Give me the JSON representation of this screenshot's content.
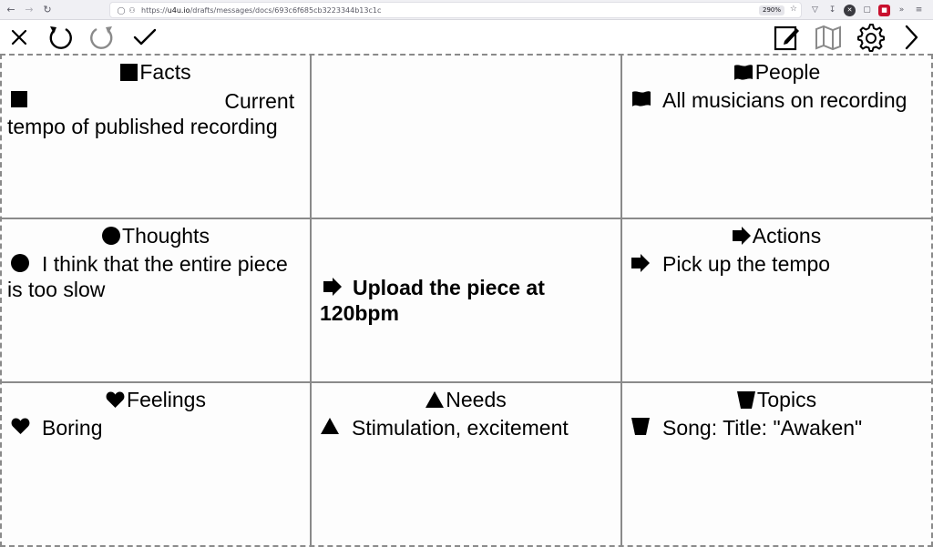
{
  "browser": {
    "url_prefix": "https://",
    "url_host": "u4u.io",
    "url_path": "/drafts/messages/docs/693c6f685cb3223344b13c1c",
    "zoom": "290%"
  },
  "toolbar": {
    "left_buttons": [
      "close-icon",
      "undo-icon",
      "redo-icon",
      "check-icon"
    ],
    "right_buttons": [
      "edit-icon",
      "map-icon",
      "gear-icon",
      "chevron-right-icon"
    ]
  },
  "cells": {
    "facts": {
      "title": "Facts",
      "icon": "square-icon",
      "item": "Current tempo of published recording"
    },
    "people": {
      "title": "People",
      "icon": "flag-icon",
      "item": "All musicians on recording"
    },
    "thoughts": {
      "title": "Thoughts",
      "icon": "circle-icon",
      "item": "I think that the entire piece is too slow"
    },
    "center": {
      "icon": "arrow-right-icon",
      "item": "Upload the piece at 120bpm"
    },
    "actions": {
      "title": "Actions",
      "icon": "arrow-right-icon",
      "item": "Pick up the tempo"
    },
    "feelings": {
      "title": "Feelings",
      "icon": "heart-icon",
      "item": "Boring"
    },
    "needs": {
      "title": "Needs",
      "icon": "triangle-icon",
      "item": "Stimulation, excitement"
    },
    "topics": {
      "title": "Topics",
      "icon": "cup-icon",
      "item": "Song: Title: \"Awaken\""
    }
  }
}
